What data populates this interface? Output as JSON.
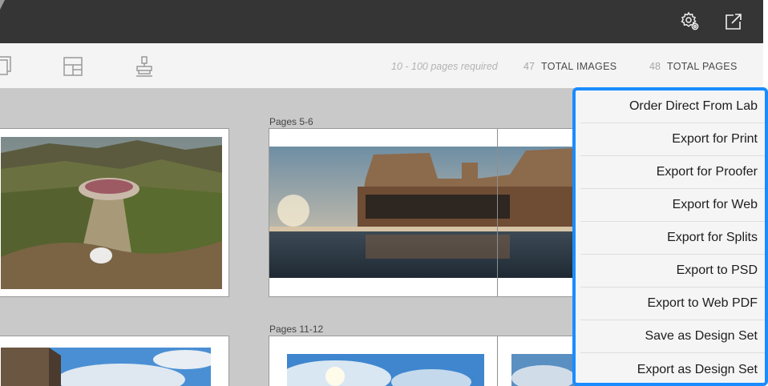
{
  "topbar": {
    "icons": [
      "settings-gear-icon",
      "external-link-icon"
    ]
  },
  "toolbar": {
    "tools": [
      "pages-stack-icon",
      "layout-grid-icon",
      "stamp-tool-icon"
    ],
    "pages_required": "10 - 100 pages required",
    "total_images_count": "47",
    "total_images_label": "TOTAL IMAGES",
    "total_pages_count": "48",
    "total_pages_label": "TOTAL PAGES"
  },
  "canvas": {
    "spreads": [
      {
        "label": ""
      },
      {
        "label": "Pages 5-6"
      },
      {
        "label": ""
      },
      {
        "label": "Pages 11-12"
      }
    ]
  },
  "menu": {
    "items": [
      {
        "label": "Order Direct From Lab"
      },
      {
        "label": "Export for Print"
      },
      {
        "label": "Export for Proofer"
      },
      {
        "label": "Export for Web"
      },
      {
        "label": "Export for Splits"
      },
      {
        "label": "Export to PSD"
      },
      {
        "label": "Export to Web PDF"
      },
      {
        "label": "Save as Design Set"
      },
      {
        "label": "Export as Design Set"
      }
    ]
  },
  "colors": {
    "topbar": "#353535",
    "toolbar": "#f4f4f4",
    "canvas": "#c9c9c9",
    "menu_border": "#1a8cff"
  }
}
